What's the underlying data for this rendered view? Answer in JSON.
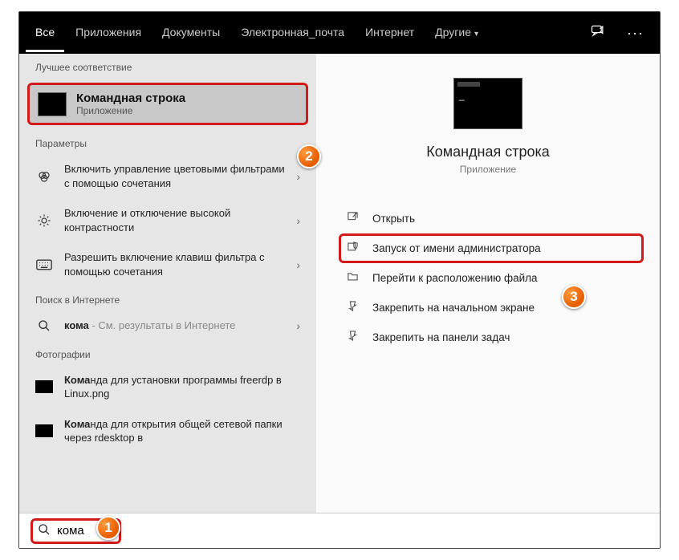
{
  "tabs": {
    "all": "Все",
    "apps": "Приложения",
    "docs": "Документы",
    "email": "Электронная_почта",
    "internet": "Интернет",
    "other": "Другие"
  },
  "sections": {
    "best": "Лучшее соответствие",
    "settings": "Параметры",
    "websearch": "Поиск в Интернете",
    "photos": "Фотографии"
  },
  "hero": {
    "prefix": "Кома",
    "rest": "ндная строка",
    "sub": "Приложение"
  },
  "settingsItems": [
    "Включить управление цветовыми фильтрами с помощью сочетания",
    "Включение и отключение высокой контрастности",
    "Разрешить включение клавиш фильтра с помощью сочетания"
  ],
  "web": {
    "prefix": "кома",
    "rest": " - См. результаты в Интернете"
  },
  "photos": [
    {
      "prefix": "Кома",
      "rest": "нда для установки программы freerdp в Linux.png"
    },
    {
      "prefix": "Кома",
      "rest": "нда для открытия общей сетевой папки через rdesktop в"
    }
  ],
  "preview": {
    "title": "Командная строка",
    "sub": "Приложение"
  },
  "actions": {
    "open": "Открыть",
    "admin": "Запуск от имени администратора",
    "location": "Перейти к расположению файла",
    "pinstart": "Закрепить на начальном экране",
    "pintask": "Закрепить на панели задач"
  },
  "search": {
    "query": "кома"
  },
  "badges": {
    "b1": "1",
    "b2": "2",
    "b3": "3"
  }
}
